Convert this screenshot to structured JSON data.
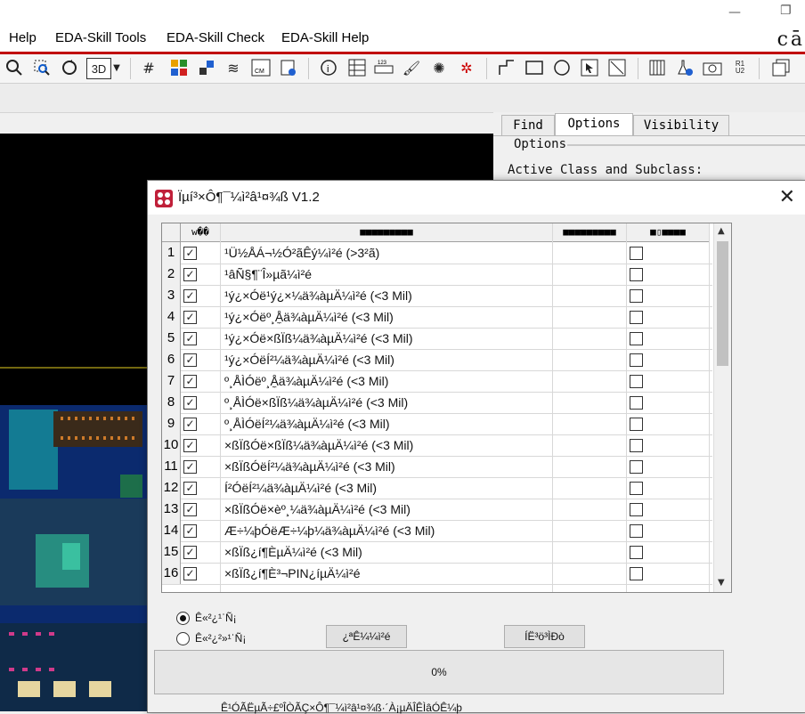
{
  "window": {
    "minimize_glyph": "—",
    "restore_glyph": "❐"
  },
  "menu": {
    "items": [
      "Help",
      "EDA-Skill Tools",
      "EDA-Skill Check",
      "EDA-Skill Help"
    ],
    "brand": "cā"
  },
  "toolbar": {
    "view_mode": "3D",
    "icons": [
      "zoom-fit-icon",
      "zoom-select-icon",
      "redraw-icon",
      "view-3d-icon",
      "grid-icon",
      "color-icon",
      "layers-icon",
      "stack-icon",
      "units-icon",
      "setup-icon",
      "info-icon",
      "table-icon",
      "ruler-icon",
      "brush-icon",
      "highlight-icon",
      "unhighlight-icon",
      "line-icon",
      "rect-icon",
      "circle-icon",
      "select-icon",
      "slope-icon",
      "spreadsheet-icon",
      "flask-icon",
      "camera-icon",
      "refdes-icon",
      "window-icon"
    ]
  },
  "right_panel": {
    "tabs": [
      "Find",
      "Options",
      "Visibility"
    ],
    "active_tab": "Options",
    "section_title": "Options",
    "active_class_label": "Active Class and Subclass:"
  },
  "dialog": {
    "title": "Ïµí³×Ô¶¯¼ì²â¹¤¾ß V1.2",
    "columns": [
      "w��",
      "■■■■■■■■■",
      "■■■■■■■■■",
      "■▯■■■■"
    ],
    "rows": [
      {
        "num": "1",
        "checked": true,
        "name": "¹Ü½ÅÁ¬½Ó²ãÊý¼ì²é  (>3²ã)"
      },
      {
        "num": "2",
        "checked": true,
        "name": "¹âÑ§¶¨Î»µã¼ì²é"
      },
      {
        "num": "3",
        "checked": true,
        "name": "¹ý¿×Óë¹ý¿×¼ä¾àµÄ¼ì²é  (<3 Mil)"
      },
      {
        "num": "4",
        "checked": true,
        "name": "¹ý¿×Óëº¸Å̼ä¾àµÄ¼ì²é  (<3 Mil)"
      },
      {
        "num": "5",
        "checked": true,
        "name": "¹ý¿×Óë×ßÏß¼ä¾àµÄ¼ì²é  (<3 Mil)"
      },
      {
        "num": "6",
        "checked": true,
        "name": "¹ý¿×ÓëÍ²¼ä¾àµÄ¼ì²é  (<3 Mil)"
      },
      {
        "num": "7",
        "checked": true,
        "name": "º¸ÅÌÓëº¸Å̼ä¾àµÄ¼ì²é  (<3 Mil)"
      },
      {
        "num": "8",
        "checked": true,
        "name": "º¸ÅÌÓë×ßÏß¼ä¾àµÄ¼ì²é  (<3 Mil)"
      },
      {
        "num": "9",
        "checked": true,
        "name": "º¸ÅÌÓëÍ²¼ä¾àµÄ¼ì²é  (<3 Mil)"
      },
      {
        "num": "10",
        "checked": true,
        "name": "×ßÏßÓë×ßÏß¼ä¾àµÄ¼ì²é  (<3 Mil)"
      },
      {
        "num": "11",
        "checked": true,
        "name": "×ßÏßÓëÍ²¼ä¾àµÄ¼ì²é  (<3 Mil)"
      },
      {
        "num": "12",
        "checked": true,
        "name": "Í²ÓëÍ²¼ä¾àµÄ¼ì²é  (<3 Mil)"
      },
      {
        "num": "13",
        "checked": true,
        "name": "×ßÏßÓë×èº¸¼ä¾àµÄ¼ì²é  (<3 Mil)"
      },
      {
        "num": "14",
        "checked": true,
        "name": "Æ÷¼þÓëÆ÷¼þ¼ä¾àµÄ¼ì²é  (<3 Mil)"
      },
      {
        "num": "15",
        "checked": true,
        "name": "×ßÏß¿í¶ÈµÄ¼ì²é              (<3 Mil)"
      },
      {
        "num": "16",
        "checked": true,
        "name": "×ßÏß¿í¶È³¬PIN¿íµÄ¼ì²é"
      }
    ],
    "radio_options": [
      {
        "label": "Ê«²¿¹ˈÑ¡",
        "checked": true
      },
      {
        "label": "Ê«²¿²»¹ˈÑ¡",
        "checked": false
      }
    ],
    "buttons": {
      "generate": "¿ªÊ¼¼ì²é",
      "report": "ÍË³ö³ÌÐò"
    },
    "progress_text": "0%",
    "progress_fraction": 0,
    "footer_text": "Ê¹ÓÃËµÃ÷£ºÎÒÃÇ×Ô¶¯¼ì²â¹¤¾ß·´À¡µÄÎÊÌâÓÊ¼þ"
  }
}
